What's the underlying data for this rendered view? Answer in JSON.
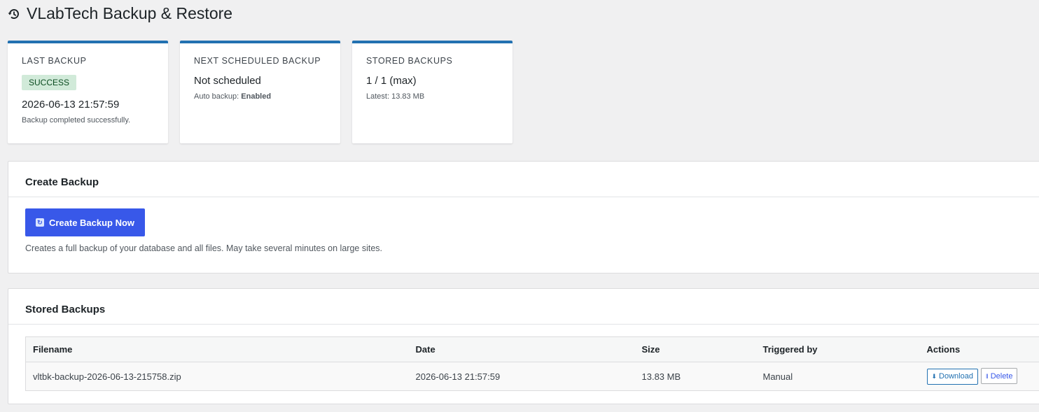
{
  "header": {
    "title": "VLabTech Backup & Restore",
    "icon": "history-icon"
  },
  "cards": [
    {
      "label": "LAST BACKUP",
      "badge": "SUCCESS",
      "value": "2026-06-13 21:57:59",
      "sub": "Backup completed successfully."
    },
    {
      "label": "NEXT SCHEDULED BACKUP",
      "value": "Not scheduled",
      "sub_prefix": "Auto backup: ",
      "sub_strong": "Enabled"
    },
    {
      "label": "STORED BACKUPS",
      "value": "1 / 1 (max)",
      "sub": "Latest: 13.83 MB"
    }
  ],
  "create_panel": {
    "title": "Create Backup",
    "button_label": "Create Backup Now",
    "button_icon": "refresh-icon",
    "help": "Creates a full backup of your database and all files. May take several minutes on large sites."
  },
  "stored_panel": {
    "title": "Stored Backups",
    "columns": [
      "Filename",
      "Date",
      "Size",
      "Triggered by",
      "Actions"
    ],
    "rows": [
      {
        "filename": "vltbk-backup-2026-06-13-215758.zip",
        "date": "2026-06-13 21:57:59",
        "size": "13.83 MB",
        "triggered_by": "Manual",
        "download_label": "Download",
        "delete_label": "Delete"
      }
    ]
  },
  "colors": {
    "accent": "#2271b1",
    "primary_button": "#3858e9",
    "success_bg": "#d1ead9"
  }
}
